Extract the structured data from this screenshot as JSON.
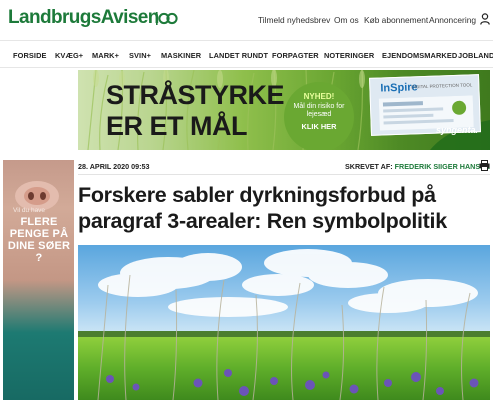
{
  "header": {
    "logo_text_1": "Landbrugs",
    "logo_text_2": "Avisen",
    "links": [
      "Tilmeld nyhedsbrev",
      "Om os",
      "Køb abonnement",
      "Annoncering"
    ]
  },
  "nav": {
    "items": [
      "FORSIDE",
      "KVÆG+",
      "MARK+",
      "SVIN+",
      "MASKINER",
      "LANDET RUNDT",
      "FORPAGTER",
      "NOTERINGER",
      "EJENDOMSMARKED",
      "JOBLANDE"
    ]
  },
  "banner_ad": {
    "headline_line1": "STRÅSTYRKE",
    "headline_line2": "ER ET MÅL",
    "badge_title": "NYHED!",
    "badge_text": "Mål din risiko for lejesæd",
    "badge_cta": "KLIK HER",
    "screen_logo": "InSpire",
    "screen_tag": "DIGITAL PROTECTION TOOL",
    "brand": "syngenta."
  },
  "side_ad": {
    "small_text": "Vil du have",
    "big_text_1": "FLERE",
    "big_text_2": "PENGE PÅ",
    "big_text_3": "DINE SØER",
    "big_text_4": "?"
  },
  "article": {
    "date": "28. APRIL 2020 09:53",
    "author_label": "SKREVET AF:",
    "author": "FREDERIK SIIGER HANSEN",
    "headline": "Forskere sabler dyrkningsforbud på paragraf 3-arealer: Ren symbolpolitik"
  },
  "colors": {
    "brand_green": "#1d7a3a",
    "banner_green": "#6aa832"
  }
}
